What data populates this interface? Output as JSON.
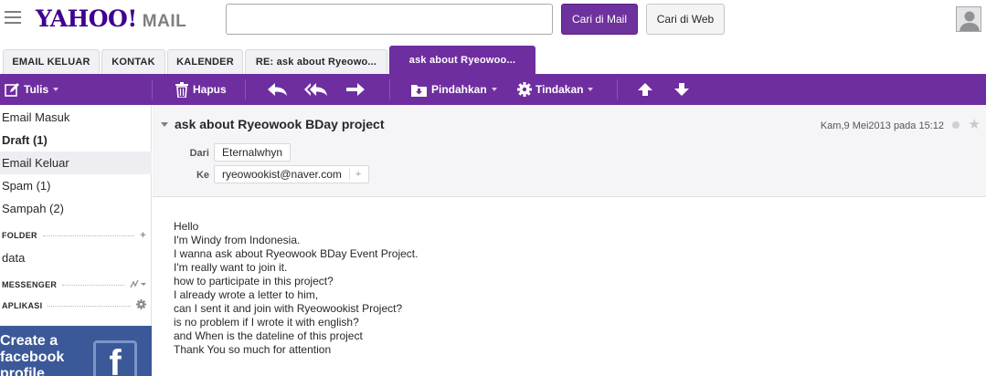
{
  "header": {
    "logo_text": "YAHOO!",
    "logo_mail": "MAIL",
    "search_value": "",
    "search_mail_label": "Cari di Mail",
    "search_web_label": "Cari di Web"
  },
  "tabs": [
    {
      "label": "EMAIL KELUAR",
      "active": false
    },
    {
      "label": "KONTAK",
      "active": false
    },
    {
      "label": "KALENDER",
      "active": false
    },
    {
      "label": "RE: ask about Ryeowo...",
      "active": false
    },
    {
      "label": "ask about Ryeowoo...",
      "active": true
    }
  ],
  "toolbar": {
    "compose_label": "Tulis",
    "delete_label": "Hapus",
    "move_label": "Pindahkan",
    "actions_label": "Tindakan"
  },
  "sidebar": {
    "items": [
      {
        "label": "Email Masuk",
        "bold": false,
        "selected": false
      },
      {
        "label": "Draft (1)",
        "bold": true,
        "selected": false
      },
      {
        "label": "Email Keluar",
        "bold": false,
        "selected": true
      },
      {
        "label": "Spam (1)",
        "bold": false,
        "selected": false
      },
      {
        "label": "Sampah (2)",
        "bold": false,
        "selected": false
      }
    ],
    "folder_heading": "FOLDER",
    "folders": [
      "data"
    ],
    "messenger_heading": "MESSENGER",
    "apps_heading": "APLIKASI",
    "ad_text": "Create a facebook profile",
    "ad_logo": "f"
  },
  "message": {
    "subject": "ask about Ryeowook BDay project",
    "date": "Kam,9 Mei2013 pada 15:12",
    "from_label": "Dari",
    "from": "Eternalwhyn",
    "to_label": "Ke",
    "to": "ryeowookist@naver.com",
    "body_lines": [
      "Hello",
      "I'm Windy from Indonesia.",
      "I wanna ask about Ryeowook BDay Event Project.",
      "I'm really want to join it.",
      "how to participate in this project?",
      "I already wrote a letter to him,",
      "can I sent it and join with Ryeowookist Project?",
      "is no problem if I wrote it with english?",
      "and When is the dateline of this project",
      "Thank You so much for attention"
    ]
  },
  "colors": {
    "brand_purple": "#6e2ea0",
    "logo_purple": "#400090",
    "facebook_blue": "#3b5998"
  }
}
